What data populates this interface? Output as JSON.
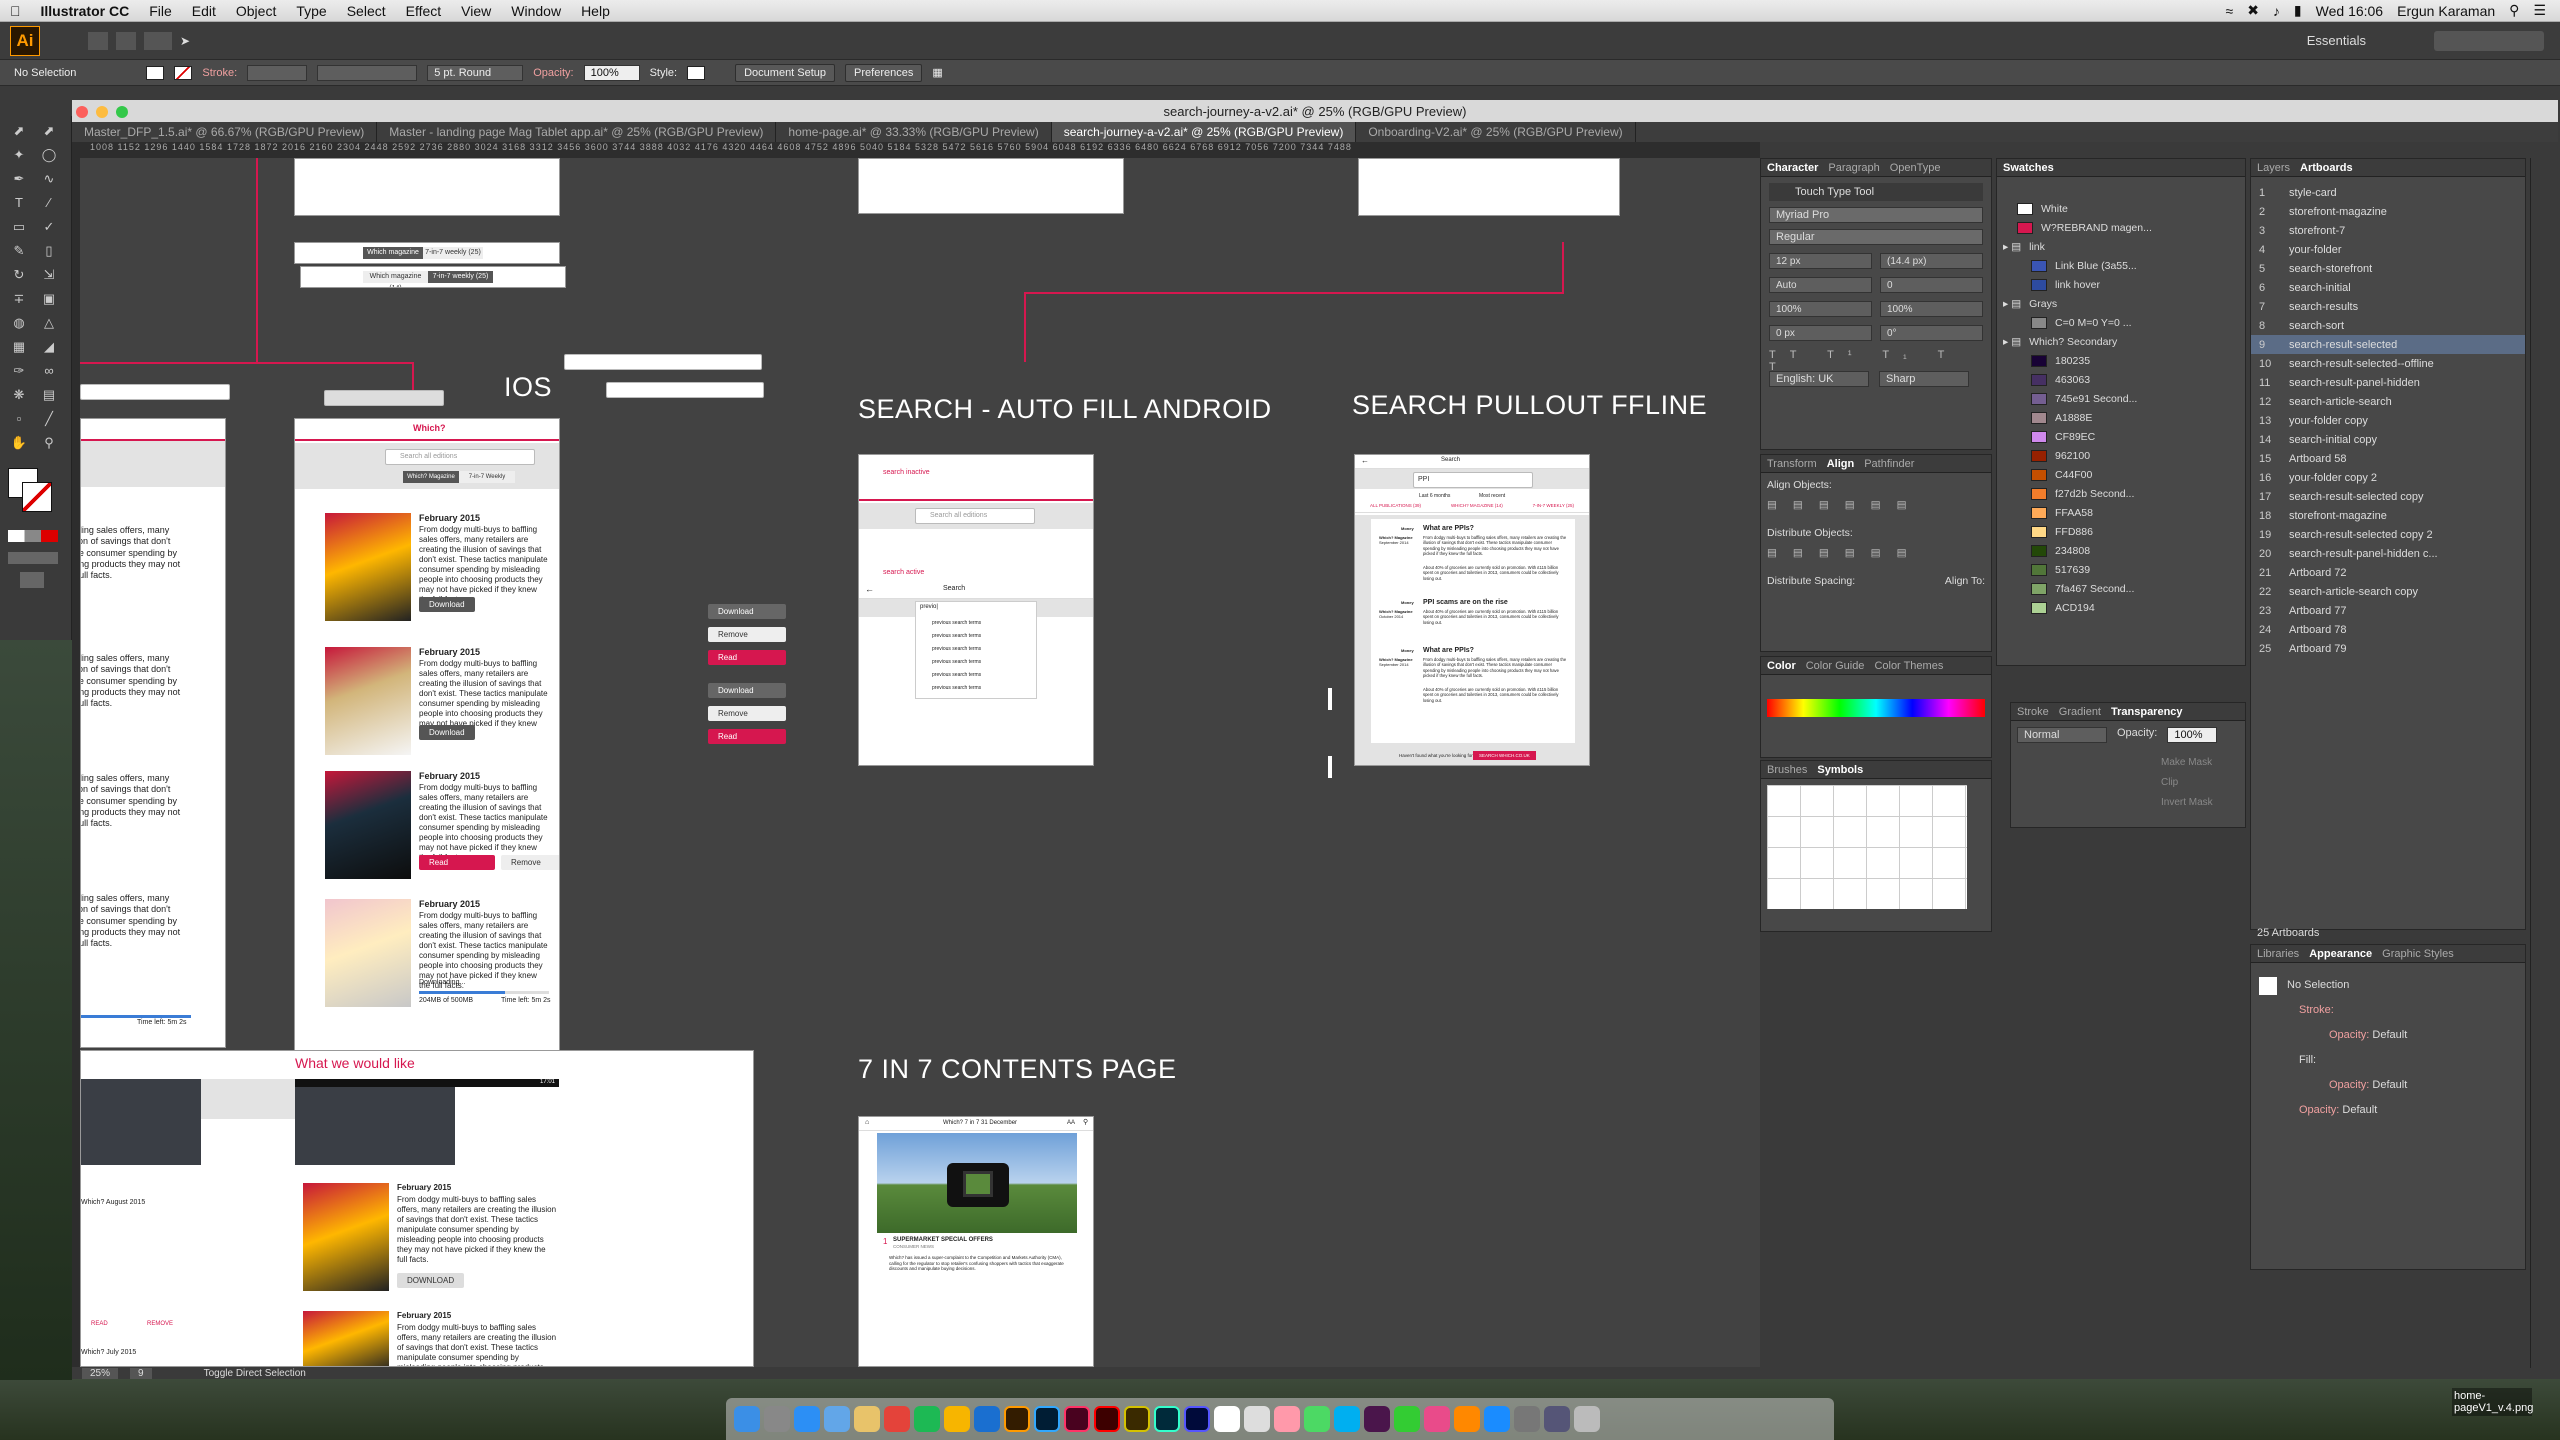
{
  "menubar": {
    "app": "Illustrator CC",
    "items": [
      "File",
      "Edit",
      "Object",
      "Type",
      "Select",
      "Effect",
      "View",
      "Window",
      "Help"
    ],
    "time": "Wed 16:06",
    "user": "Ergun Karaman"
  },
  "appbar": {
    "logo": "Ai",
    "workspace": "Essentials"
  },
  "control": {
    "selection": "No Selection",
    "stroke_label": "Stroke:",
    "brush": "5 pt. Round",
    "opacity_label": "Opacity:",
    "opacity_value": "100%",
    "style_label": "Style:",
    "doc_setup": "Document Setup",
    "preferences": "Preferences"
  },
  "document": {
    "title": "search-journey-a-v2.ai* @ 25% (RGB/GPU Preview)",
    "tabs": [
      "Master_DFP_1.5.ai* @ 66.67% (RGB/GPU Preview)",
      "Master - landing page Mag Tablet app.ai* @ 25% (RGB/GPU Preview)",
      "home-page.ai* @ 33.33% (RGB/GPU Preview)",
      "search-journey-a-v2.ai* @ 25% (RGB/GPU Preview)",
      "Onboarding-V2.ai* @ 25% (RGB/GPU Preview)"
    ],
    "ruler": "1008 1152 1296 1440 1584 1728 1872 2016 2160 2304 2448 2592 2736 2880 3024 3168 3312 3456 3600 3744 3888 4032 4176 4320 4464 4608 4752 4896 5040 5184 5328 5472 5616 5760 5904 6048 6192 6336 6480 6624 6768 6912 7056 7200 7344 7488"
  },
  "canvas": {
    "labels": {
      "ios": "IOS",
      "autofill": "SEARCH - AUTO FILL ANDROID",
      "pullout": "SEARCH PULLOUT FFLINE",
      "contents": "7 IN 7 CONTENTS PAGE",
      "would_like": "What we would like"
    },
    "segments": {
      "a": "Which magazine (14)",
      "b": "7-in-7 weekly (25)"
    },
    "ios_board": {
      "search_placeholder": "Search all editions",
      "seg_a": "Which? Magazine",
      "seg_b": "7-in-7 Weekly",
      "issue": "February 2015",
      "blurb": "From dodgy multi-buys to baffling sales offers, many retailers are creating the illusion of savings that don't exist. These tactics manipulate consumer spending by misleading people into choosing products they may not have picked if they knew the full facts.",
      "download": "Download",
      "read": "Read",
      "remove": "Remove",
      "downloading": "Downloading...",
      "size": "204MB of 500MB",
      "time_left": "Time left: 5m 2s"
    },
    "side_buttons": [
      "Download",
      "Remove",
      "Read",
      "Download",
      "Remove",
      "Read"
    ],
    "autofill_board": {
      "inactive": "search inactive",
      "active": "search active",
      "search_title": "Search",
      "query": "previo|",
      "suggestion": "previous search terms",
      "suggestions_count_label": "",
      "search_all": "Search all editions"
    },
    "pullout_board": {
      "title": "Search",
      "query": "PPI",
      "filter_a": "Last 6 months",
      "filter_b": "Most recent",
      "tab_all": "ALL PUBLICATIONS (39)",
      "tab_mag": "WHICH? MAGAZINE (14)",
      "tab_weekly": "7-IN-7 WEEKLY (25)",
      "results": [
        {
          "section": "Money",
          "pub": "Which? Magazine",
          "date": "September 2014",
          "title": "What are PPIs?",
          "body": "From dodgy multi-buys to baffling sales offers, many retailers are creating the illusion of savings that don't exist. These tactics manipulate consumer spending by misleading people into choosing products they may not have picked if they knew the full facts.",
          "body2": "About 40% of groceries are currently sold on promotion. With £115 billion spent on groceries and toiletries in 2013, consumers could be collectively losing out."
        },
        {
          "section": "Money",
          "pub": "Which? Magazine",
          "date": "October 2014",
          "title": "PPI scams are on the rise",
          "body": "About 40% of groceries are currently sold on promotion. With £115 billion spent on groceries and toiletries in 2013, consumers could be collectively losing out.",
          "body2": ""
        },
        {
          "section": "Money",
          "pub": "Which? Magazine",
          "date": "September 2014",
          "title": "What are PPIs?",
          "body": "From dodgy multi-buys to baffling sales offers, many retailers are creating the illusion of savings that don't exist. These tactics manipulate consumer spending by misleading people into choosing products they may not have picked if they knew the full facts.",
          "body2": "About 40% of groceries are currently sold on promotion. With £115 billion spent on groceries and toiletries in 2013, consumers could be collectively losing out."
        }
      ],
      "footer_q": "Haven't found what you're looking for?",
      "footer_btn": "SEARCH WHICH.CO.UK"
    },
    "contents_board": {
      "header": "Which? 7 in 7 31 December",
      "aa": "AA",
      "article_num": "1",
      "article_title": "SUPERMARKET SPECIAL OFFERS",
      "article_sub": "CONSUMER NEWS",
      "article_body": "Which? has issued a super-complaint to the Competition and Markets Authority (CMA), calling for the regulator to stop retailer's confusing shoppers with tactics that exaggerate discounts and manipulate buying decisions."
    },
    "would_like_board": {
      "issue": "February 2015",
      "blurb": "From dodgy multi-buys to baffling sales offers, many retailers are creating the illusion of savings that don't exist. These tactics manipulate consumer spending by misleading people into choosing products they may not have picked if they knew the full facts.",
      "download": "DOWNLOAD",
      "read": "READ",
      "remove": "REMOVE",
      "prev_issue": "Which? August 2015",
      "prev_issue2": "Which? July 2015",
      "status_time": "17:01"
    }
  },
  "character_panel": {
    "tabs": [
      "Character",
      "Paragraph",
      "OpenType"
    ],
    "touch_tool": "Touch Type Tool",
    "font": "Myriad Pro",
    "style": "Regular",
    "size": "12 px",
    "leading": "(14.4 px)",
    "kerning": "Auto",
    "tracking": "0",
    "vscale": "100%",
    "hscale": "100%",
    "baseline": "0 px",
    "rotation": "0°",
    "language": "English: UK",
    "antialias": "Sharp"
  },
  "align_panel": {
    "tabs": [
      "Transform",
      "Align",
      "Pathfinder"
    ],
    "align_objects": "Align Objects:",
    "distribute_objects": "Distribute Objects:",
    "distribute_spacing": "Distribute Spacing:",
    "align_to": "Align To:"
  },
  "color_panel": {
    "tabs": [
      "Color",
      "Color Guide",
      "Color Themes"
    ]
  },
  "brushes_panel": {
    "tabs": [
      "Brushes",
      "Symbols"
    ]
  },
  "transparency_panel": {
    "tabs": [
      "Stroke",
      "Gradient",
      "Transparency"
    ],
    "mode": "Normal",
    "opacity_label": "Opacity:",
    "opacity": "100%",
    "make_mask": "Make Mask",
    "clip": "Clip",
    "invert": "Invert Mask"
  },
  "swatches_panel": {
    "title": "Swatches",
    "rows": [
      {
        "name": "White",
        "color": "#ffffff",
        "indent": 0
      },
      {
        "name": "W?REBRAND magen...",
        "color": "#d6174f",
        "indent": 0
      },
      {
        "name": "link",
        "color": "",
        "indent": -1
      },
      {
        "name": "Link Blue (3a55...",
        "color": "#3a55b4",
        "indent": 1
      },
      {
        "name": "link hover",
        "color": "#2d4ba0",
        "indent": 1
      },
      {
        "name": "Grays",
        "color": "",
        "indent": -1
      },
      {
        "name": "C=0 M=0 Y=0 ...",
        "color": "#888888",
        "indent": 1
      },
      {
        "name": "Which? Secondary",
        "color": "",
        "indent": -1
      },
      {
        "name": "180235",
        "color": "#180235",
        "indent": 1
      },
      {
        "name": "463063",
        "color": "#463063",
        "indent": 1
      },
      {
        "name": "745e91 Second...",
        "color": "#745e91",
        "indent": 1
      },
      {
        "name": "A1888E",
        "color": "#a1888e",
        "indent": 1
      },
      {
        "name": "CF89EC",
        "color": "#cf89ec",
        "indent": 1
      },
      {
        "name": "962100",
        "color": "#962100",
        "indent": 1
      },
      {
        "name": "C44F00",
        "color": "#c44f00",
        "indent": 1
      },
      {
        "name": "f27d2b Second...",
        "color": "#f27d2b",
        "indent": 1
      },
      {
        "name": "FFAA58",
        "color": "#ffaa58",
        "indent": 1
      },
      {
        "name": "FFD886",
        "color": "#ffd886",
        "indent": 1
      },
      {
        "name": "234808",
        "color": "#234808",
        "indent": 1
      },
      {
        "name": "517639",
        "color": "#517639",
        "indent": 1
      },
      {
        "name": "7fa467 Second...",
        "color": "#7fa467",
        "indent": 1
      },
      {
        "name": "ACD194",
        "color": "#acd194",
        "indent": 1
      }
    ]
  },
  "artboards_panel": {
    "tabs": [
      "Layers",
      "Artboards"
    ],
    "rows": [
      {
        "n": "1",
        "name": "style-card"
      },
      {
        "n": "2",
        "name": "storefront-magazine"
      },
      {
        "n": "3",
        "name": "storefront-7"
      },
      {
        "n": "4",
        "name": "your-folder"
      },
      {
        "n": "5",
        "name": "search-storefront"
      },
      {
        "n": "6",
        "name": "search-initial"
      },
      {
        "n": "7",
        "name": "search-results"
      },
      {
        "n": "8",
        "name": "search-sort"
      },
      {
        "n": "9",
        "name": "search-result-selected"
      },
      {
        "n": "10",
        "name": "search-result-selected--offline"
      },
      {
        "n": "11",
        "name": "search-result-panel-hidden"
      },
      {
        "n": "12",
        "name": "search-article-search"
      },
      {
        "n": "13",
        "name": "your-folder copy"
      },
      {
        "n": "14",
        "name": "search-initial copy"
      },
      {
        "n": "15",
        "name": "Artboard 58"
      },
      {
        "n": "16",
        "name": "your-folder copy 2"
      },
      {
        "n": "17",
        "name": "search-result-selected copy"
      },
      {
        "n": "18",
        "name": "storefront-magazine"
      },
      {
        "n": "19",
        "name": "search-result-selected copy 2"
      },
      {
        "n": "20",
        "name": "search-result-panel-hidden c..."
      },
      {
        "n": "21",
        "name": "Artboard 72"
      },
      {
        "n": "22",
        "name": "search-article-search copy"
      },
      {
        "n": "23",
        "name": "Artboard 77"
      },
      {
        "n": "24",
        "name": "Artboard 78"
      },
      {
        "n": "25",
        "name": "Artboard 79"
      }
    ],
    "selected": 8,
    "count": "25 Artboards"
  },
  "appearance_panel": {
    "tabs": [
      "Libraries",
      "Appearance",
      "Graphic Styles"
    ],
    "selection": "No Selection",
    "stroke": "Stroke:",
    "fill": "Fill:",
    "opacity": "Opacity:",
    "opacity_val": "Default"
  },
  "statusbar": {
    "zoom": "25%",
    "artboard": "9",
    "tool": "Toggle Direct Selection"
  },
  "desktop_file": {
    "name": "home-pageV1_v.4.png"
  }
}
